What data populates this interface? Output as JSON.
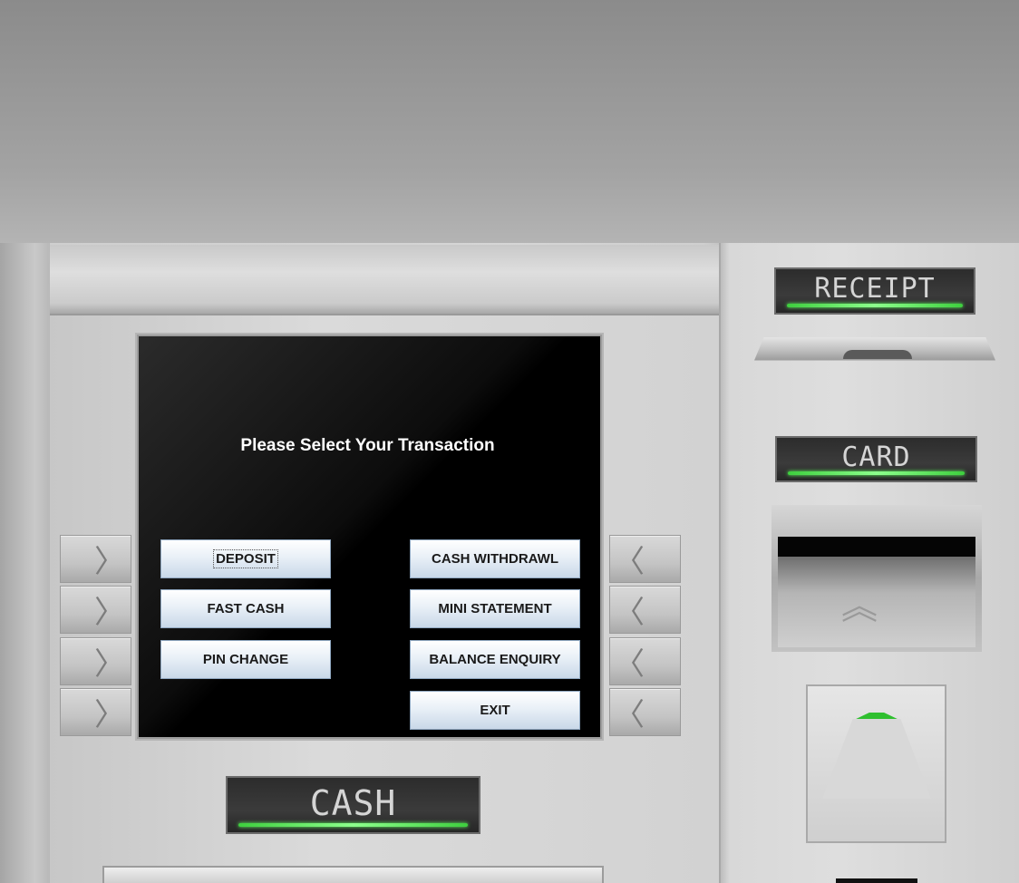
{
  "screen": {
    "title": "Please Select Your Transaction"
  },
  "transactions": {
    "left": [
      {
        "label": "DEPOSIT",
        "focused": true
      },
      {
        "label": "FAST CASH"
      },
      {
        "label": "PIN CHANGE"
      }
    ],
    "right": [
      {
        "label": "CASH WITHDRAWL"
      },
      {
        "label": "MINI STATEMENT"
      },
      {
        "label": "BALANCE ENQUIRY"
      },
      {
        "label": "EXIT"
      }
    ]
  },
  "side_keys": {
    "left_glyph": "〉",
    "right_glyph": "〈"
  },
  "plates": {
    "receipt": "RECEIPT",
    "card": "CARD",
    "cash": "CASH"
  },
  "card_slot": {
    "chevron_glyph": "︽"
  },
  "colors": {
    "led_green": "#5cff5c",
    "screen_bg": "#000000",
    "button_gradient_bottom": "#c9d8e8"
  }
}
